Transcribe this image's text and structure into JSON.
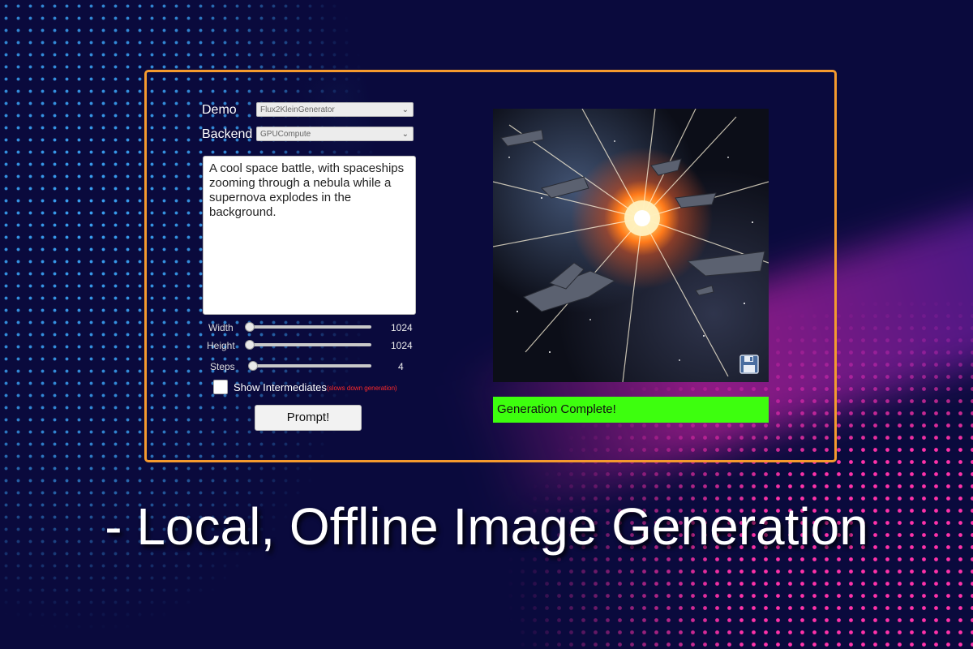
{
  "demo": {
    "label": "Demo",
    "value": "Flux2KleinGenerator"
  },
  "backend": {
    "label": "Backend",
    "value": "GPUCompute"
  },
  "prompt_text": "A cool space battle, with spaceships zooming through a nebula while a supernova explodes in the background.",
  "sliders": [
    {
      "label": "Width",
      "value": "1024",
      "fraction": 0.0
    },
    {
      "label": "Height",
      "value": "1024",
      "fraction": 0.0
    },
    {
      "label": "Steps",
      "value": "4",
      "fraction": 0.03
    }
  ],
  "show_intermediates": {
    "label": "Show Intermediates",
    "note": "(slows down generation)",
    "checked": false
  },
  "prompt_button": "Prompt!",
  "status_text": "Generation Complete!",
  "caption": "- Local, Offline Image Generation",
  "icons": {
    "save": "floppy-disk-icon",
    "dropdown": "chevron-down-icon"
  },
  "colors": {
    "frame": "#f59a2e",
    "status": "#3dff0e",
    "note": "#ff2a2a"
  }
}
